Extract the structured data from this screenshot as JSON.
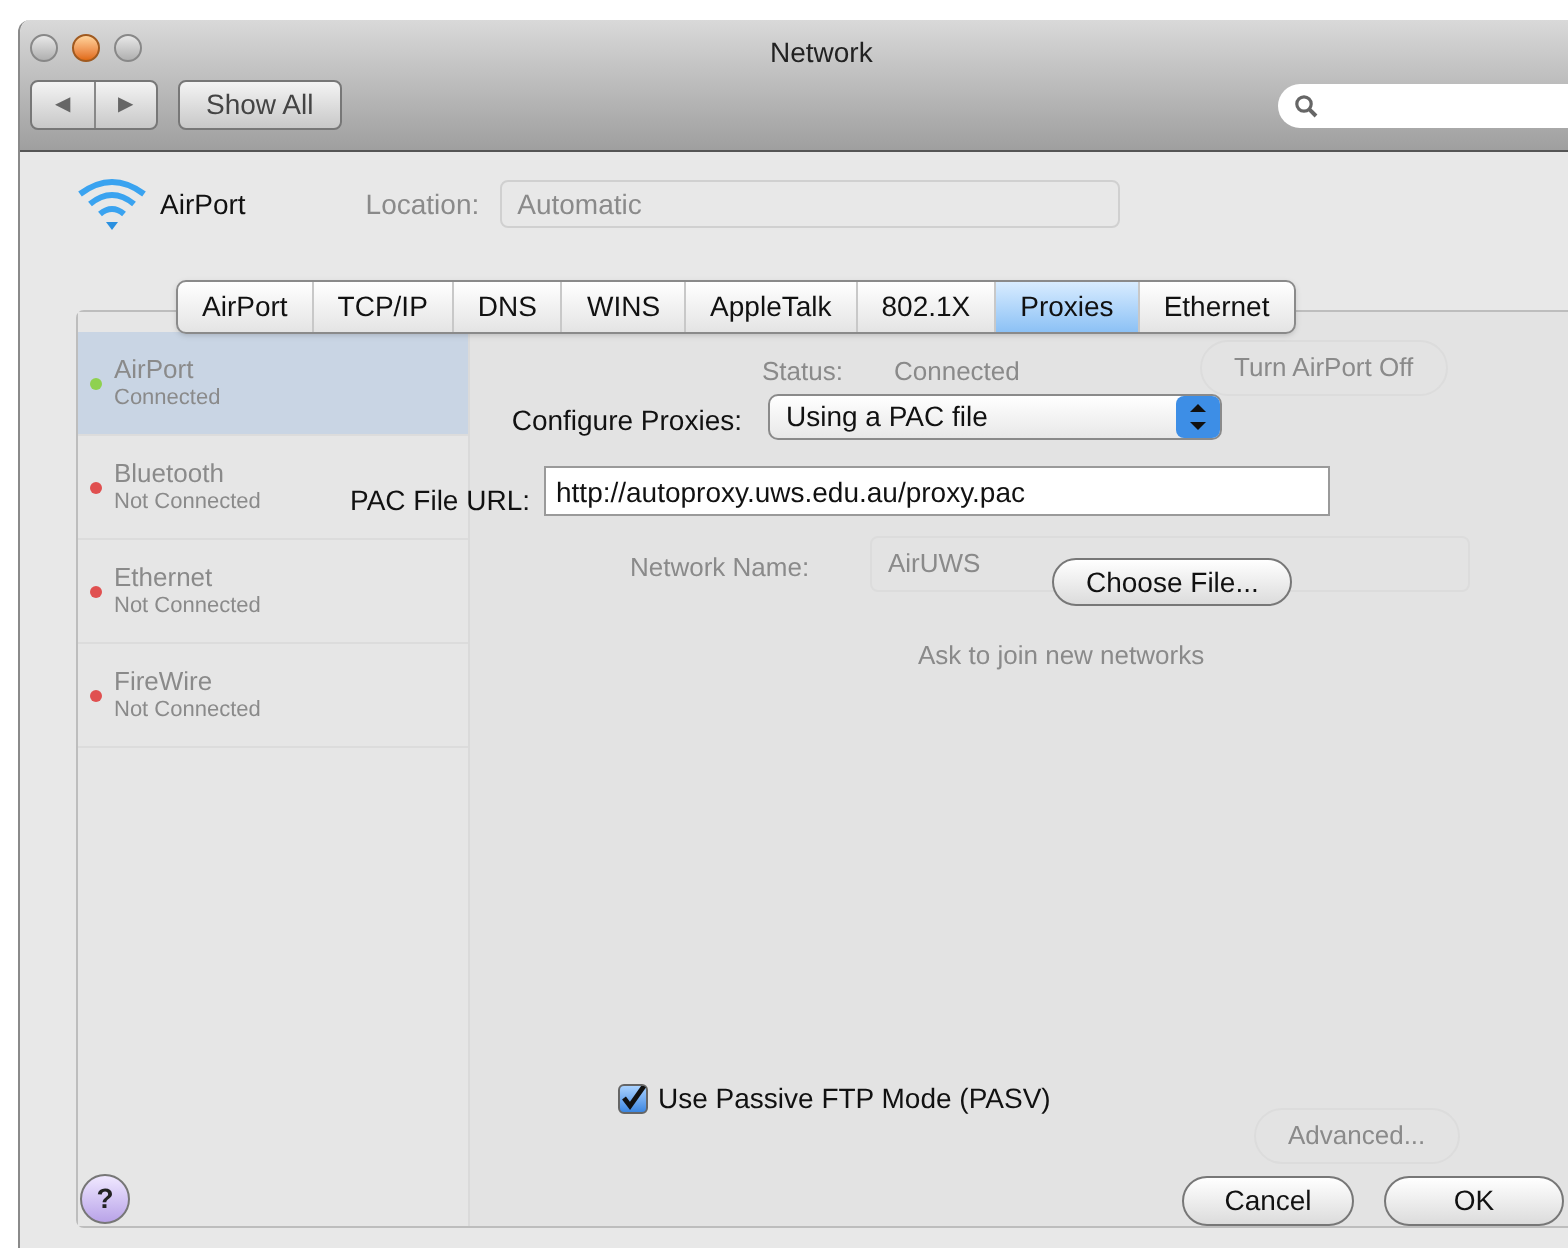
{
  "window": {
    "title": "Network",
    "nav_buttons": [
      "◀",
      "▶"
    ],
    "show_all": "Show All"
  },
  "service": {
    "name": "AirPort"
  },
  "background": {
    "location_label": "Location:",
    "location_value": "Automatic",
    "status_label": "Status:",
    "status_value": "Connected",
    "turn_off": "Turn AirPort Off",
    "network_name_label": "Network Name:",
    "network_name_value": "AirUWS",
    "ask_to_join": "Ask to join new networks",
    "advanced": "Advanced...",
    "services": [
      {
        "name": "AirPort",
        "status": "Connected",
        "color": "#8fd14f",
        "selected": true
      },
      {
        "name": "Bluetooth",
        "status": "Not Connected",
        "color": "#e05050",
        "selected": false
      },
      {
        "name": "Ethernet",
        "status": "Not Connected",
        "color": "#e05050",
        "selected": false
      },
      {
        "name": "FireWire",
        "status": "Not Connected",
        "color": "#e05050",
        "selected": false
      }
    ]
  },
  "tabs": [
    {
      "label": "AirPort",
      "selected": false
    },
    {
      "label": "TCP/IP",
      "selected": false
    },
    {
      "label": "DNS",
      "selected": false
    },
    {
      "label": "WINS",
      "selected": false
    },
    {
      "label": "AppleTalk",
      "selected": false
    },
    {
      "label": "802.1X",
      "selected": false
    },
    {
      "label": "Proxies",
      "selected": true
    },
    {
      "label": "Ethernet",
      "selected": false
    }
  ],
  "configure_proxies": {
    "label": "Configure Proxies:",
    "value": "Using a PAC file"
  },
  "pac_url": {
    "label": "PAC File URL:",
    "value": "http://autoproxy.uws.edu.au/proxy.pac"
  },
  "choose_file": "Choose File...",
  "passive_ftp": {
    "label": "Use Passive FTP Mode (PASV)",
    "checked": true
  },
  "help": "?",
  "buttons": [
    {
      "label": "Cancel",
      "kind": "cancel"
    },
    {
      "label": "OK",
      "kind": "ok"
    }
  ]
}
